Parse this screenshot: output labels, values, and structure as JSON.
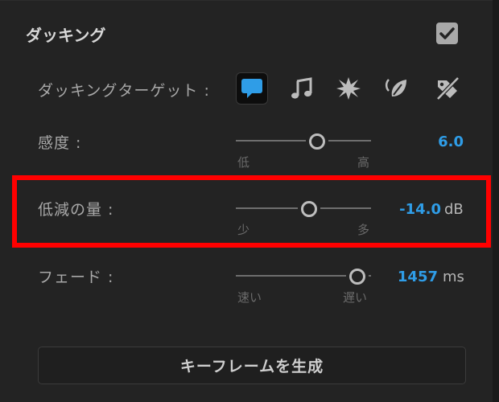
{
  "section": {
    "title": "ダッキング",
    "enabled": true
  },
  "target": {
    "label": "ダッキングターゲット :",
    "icons": [
      "speech-bubble-icon",
      "music-note-icon",
      "burst-icon",
      "leaf-icon",
      "tag-slash-icon"
    ],
    "selected": "speech-bubble-icon"
  },
  "sensitivity": {
    "label": "感度 :",
    "value": "6.0",
    "level": 0.6,
    "min_label": "低",
    "max_label": "高"
  },
  "reduction": {
    "label": "低減の量 :",
    "value": "-14.0",
    "unit": "dB",
    "level": 0.54,
    "min_label": "少",
    "max_label": "多"
  },
  "fade": {
    "label": "フェード :",
    "value": "1457",
    "unit": "ms",
    "level": 0.9,
    "min_label": "速い",
    "max_label": "遅い"
  },
  "generate_button": {
    "label": "キーフレームを生成"
  },
  "colors": {
    "accent": "#2f9de7",
    "highlight": "#ff0000",
    "background": "#232323"
  }
}
